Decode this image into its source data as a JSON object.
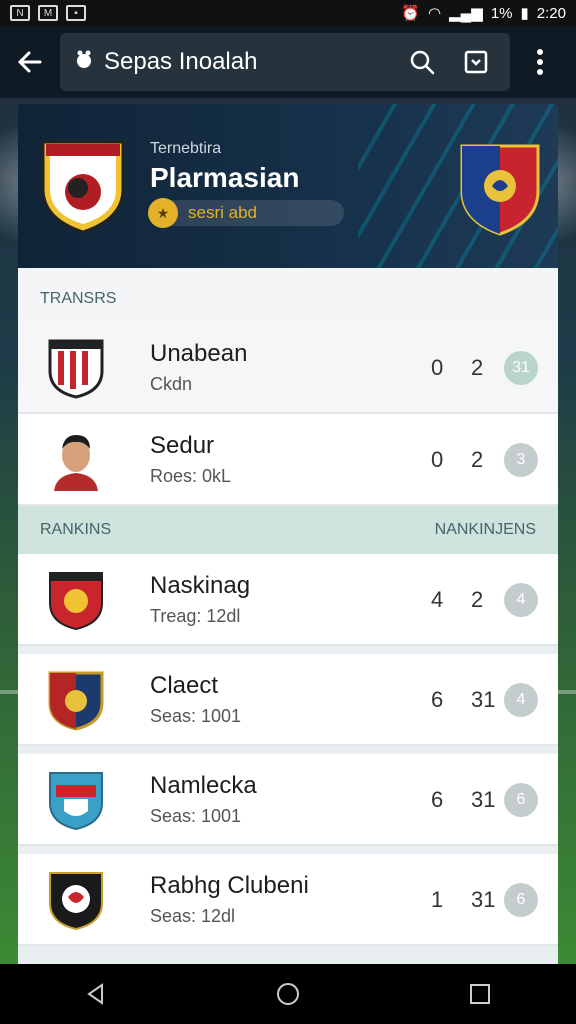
{
  "status_bar": {
    "battery": "1%",
    "time": "2:20"
  },
  "toolbar": {
    "title": "Sepas Inoalah"
  },
  "header": {
    "subtitle": "Ternebtira",
    "title": "Plarmasian",
    "pill_text": "sesri abd"
  },
  "transfers": {
    "label": "TRANSRS",
    "rows": [
      {
        "name": "Unabean",
        "sub": "Ckdn",
        "n1": "0",
        "n2": "2",
        "badge": "31"
      },
      {
        "name": "Sedur",
        "sub": "Roes: 0kL",
        "n1": "0",
        "n2": "2",
        "badge": "3"
      }
    ]
  },
  "rankings": {
    "label": "RANKINS",
    "label_right": "NANKINJENS",
    "rows": [
      {
        "name": "Naskinag",
        "sub": "Treag: 12dl",
        "n1": "4",
        "n2": "2",
        "badge": "4"
      },
      {
        "name": "Claect",
        "sub": "Seas: 1001",
        "n1": "6",
        "n2": "31",
        "badge": "4"
      },
      {
        "name": "Namlecka",
        "sub": "Seas: 1001",
        "n1": "6",
        "n2": "31",
        "badge": "6"
      },
      {
        "name": "Rabhg Clubeni",
        "sub": "Seas: 12dl",
        "n1": "1",
        "n2": "31",
        "badge": "6"
      }
    ]
  }
}
